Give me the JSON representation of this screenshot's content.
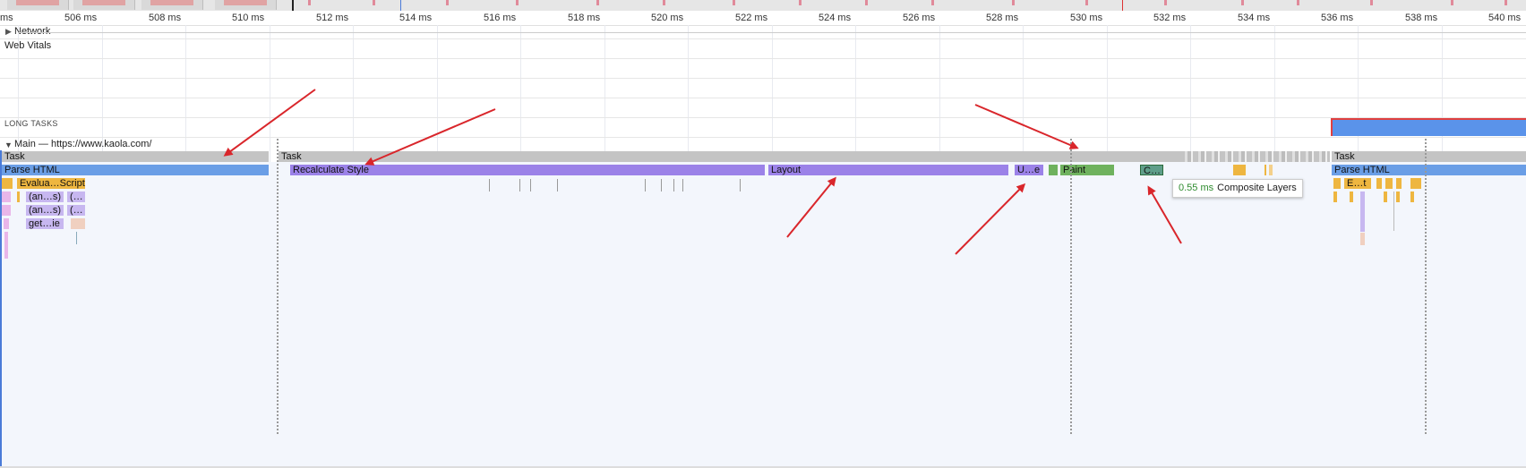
{
  "ruler": {
    "labels": [
      "ms",
      "506 ms",
      "508 ms",
      "510 ms",
      "512 ms",
      "514 ms",
      "516 ms",
      "518 ms",
      "520 ms",
      "522 ms",
      "524 ms",
      "526 ms",
      "528 ms",
      "530 ms",
      "532 ms",
      "534 ms",
      "536 ms",
      "538 ms",
      "540 ms"
    ]
  },
  "tracks": {
    "network": "Network",
    "web_vitals": "Web Vitals",
    "long_tasks": "LONG TASKS",
    "main": "Main — https://www.kaola.com/"
  },
  "flame": {
    "task_left": "Task",
    "task_mid": "Task",
    "task_right": "Task",
    "parse_left": "Parse HTML",
    "recalc": "Recalculate Style",
    "layout": "Layout",
    "update": "U…e",
    "paint": "Paint",
    "composite": "C…",
    "parse_right": "Parse HTML",
    "evaluate": "Evalua…Script",
    "anon1": "(an…s)",
    "anon1b": "(…",
    "anon2": "(an…s)",
    "anon2b": "(…",
    "get": "get…ie",
    "et": "E…t"
  },
  "tooltip": {
    "duration": "0.55 ms",
    "name": "Composite Layers"
  },
  "colors": {
    "task": "#c4c4c4",
    "parse_html": "#6a9ee6",
    "recalculate_style": "#9b82e8",
    "paint": "#6fb25e",
    "scripting": "#eeb640",
    "annotation_arrows": "#d9262b"
  }
}
